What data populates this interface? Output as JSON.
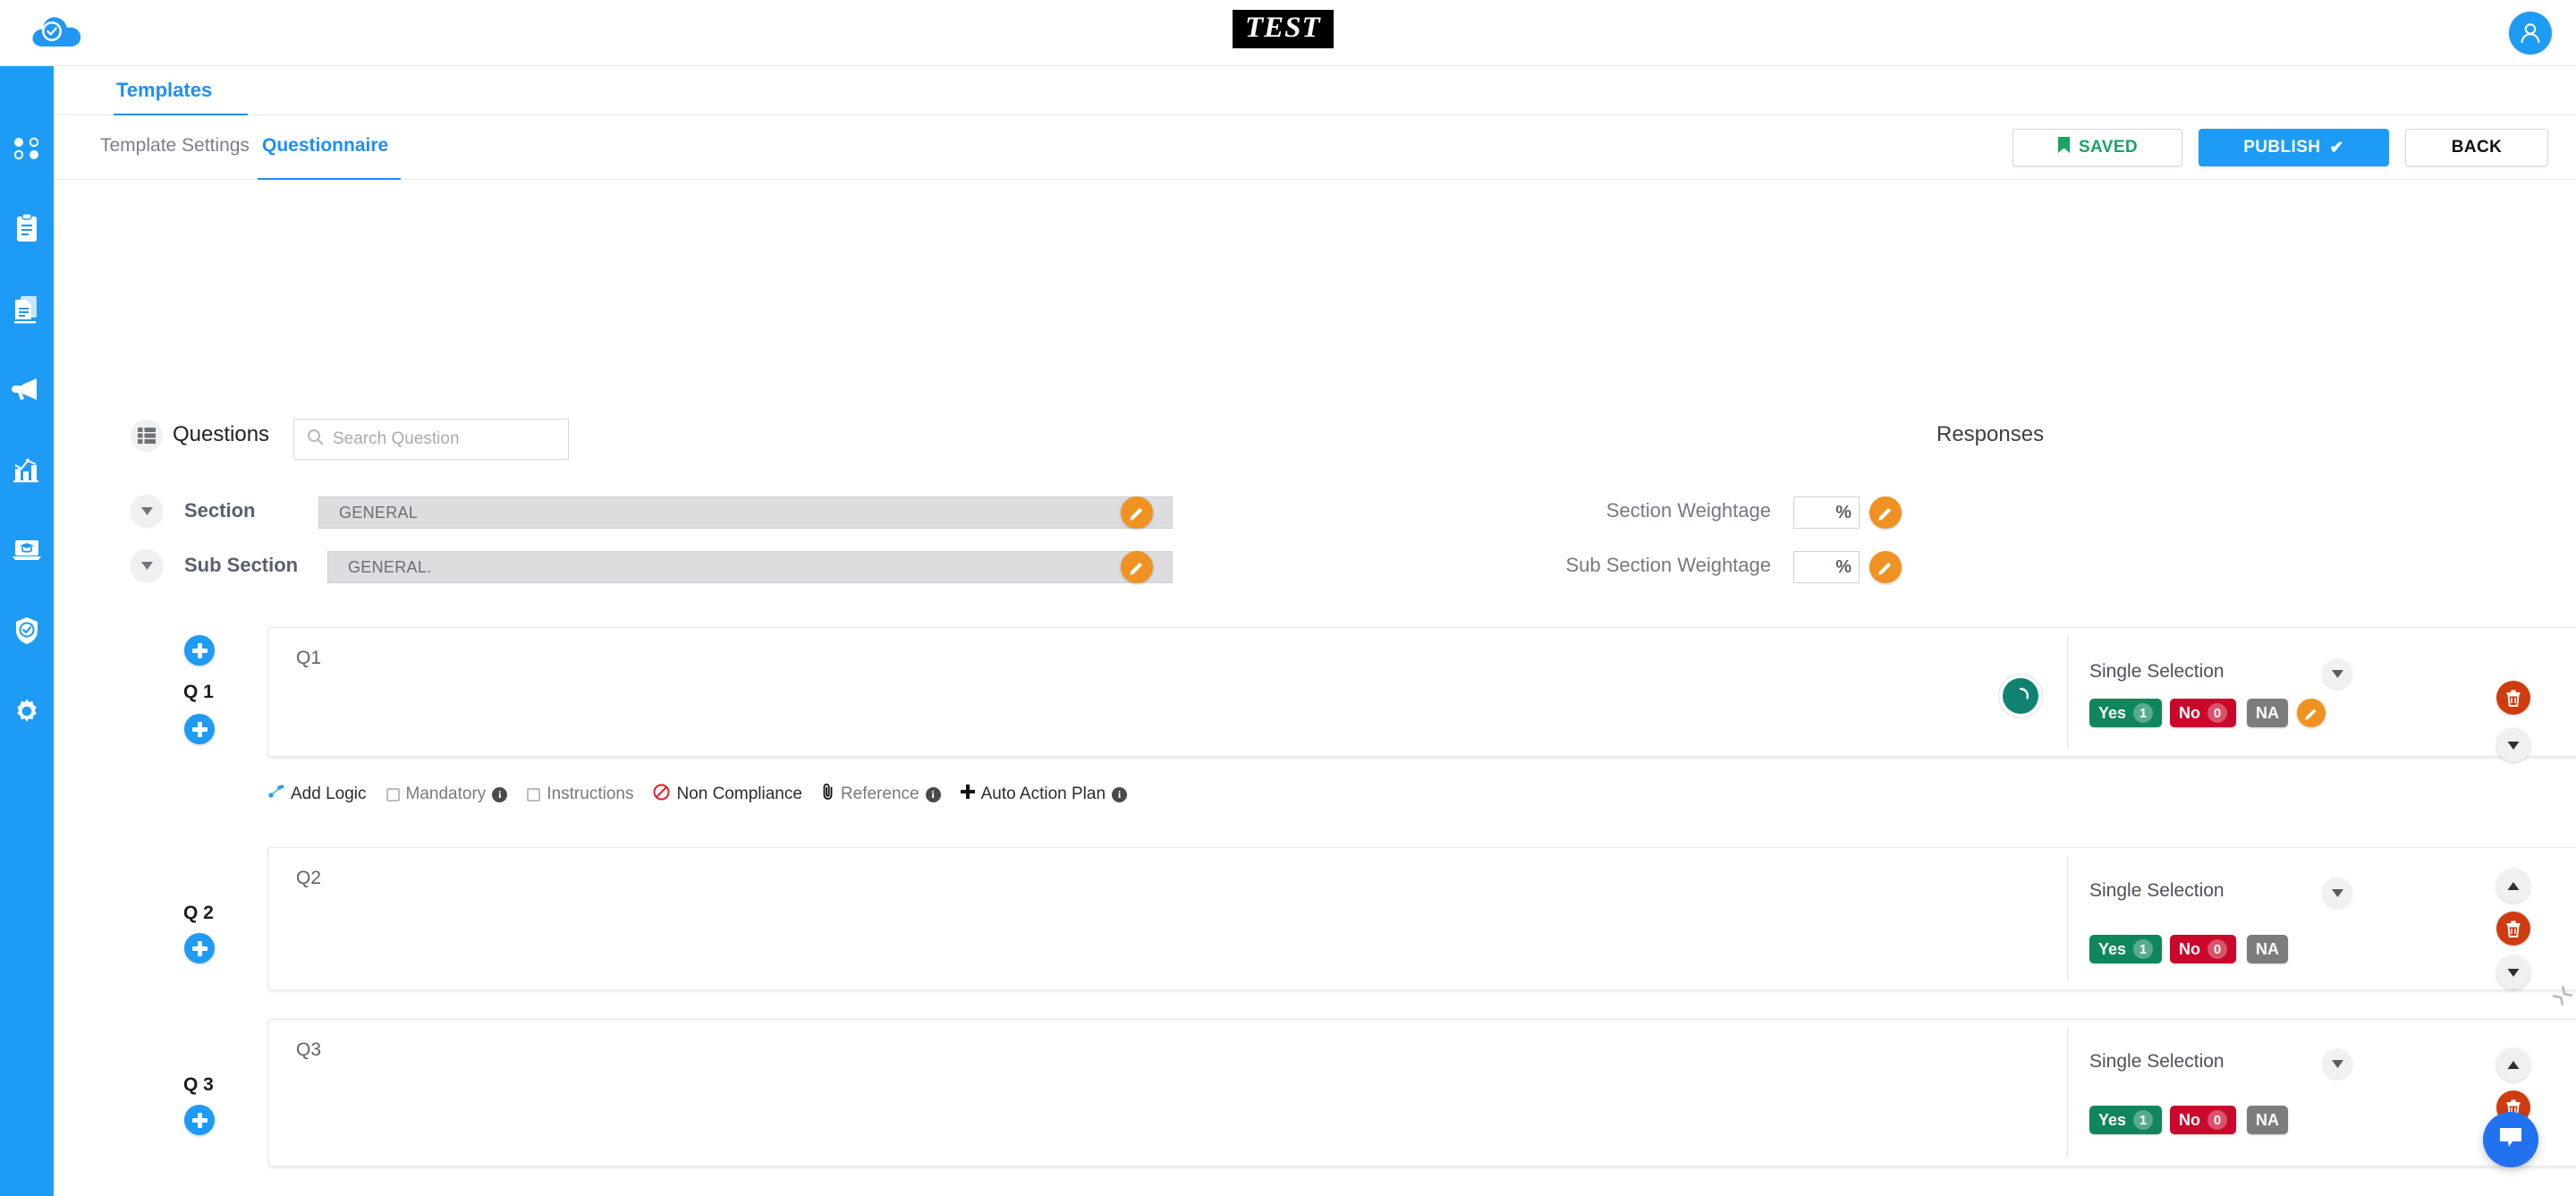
{
  "app": {
    "logo_alt": "cloud-check-logo",
    "center_logo_text": "TEST",
    "avatar_alt": "user-avatar"
  },
  "nav": {
    "items": [
      {
        "name": "dashboard",
        "icon": "four-dots-icon"
      },
      {
        "name": "clipboard",
        "icon": "clipboard-icon"
      },
      {
        "name": "documents",
        "icon": "documents-icon"
      },
      {
        "name": "announcements",
        "icon": "megaphone-icon"
      },
      {
        "name": "analytics",
        "icon": "bar-chart-icon"
      },
      {
        "name": "learning",
        "icon": "graduation-laptop-icon"
      },
      {
        "name": "compliance",
        "icon": "shield-check-icon"
      },
      {
        "name": "settings",
        "icon": "gear-icon"
      }
    ]
  },
  "tabs": {
    "primary": "Templates",
    "secondary": [
      {
        "label": "Template Settings",
        "active": false
      },
      {
        "label": "Questionnaire",
        "active": true
      }
    ]
  },
  "toolbar": {
    "saved_label": "SAVED",
    "publish_label": "PUBLISH",
    "publish_check": "✔",
    "back_label": "BACK"
  },
  "builder": {
    "questions_label": "Questions",
    "responses_label": "Responses",
    "search": {
      "value": "",
      "placeholder": "Search Question"
    },
    "section": {
      "label": "Section",
      "value": "GENERAL",
      "weightage_label": "Section Weightage",
      "weightage_value": "",
      "weightage_unit": "%"
    },
    "sub_section": {
      "label": "Sub Section",
      "value": "GENERAL.",
      "weightage_label": "Sub Section Weightage",
      "weightage_value": "",
      "weightage_unit": "%"
    },
    "response_chips": {
      "yes_label": "Yes",
      "yes_score": "1",
      "no_label": "No",
      "no_score": "0",
      "na_label": "NA"
    },
    "selection_type": "Single Selection",
    "questions": [
      {
        "rail": "Q 1",
        "text": "Q1",
        "type": "Single Selection",
        "expanded": true
      },
      {
        "rail": "Q 2",
        "text": "Q2",
        "type": "Single Selection",
        "expanded": false
      },
      {
        "rail": "Q 3",
        "text": "Q3",
        "type": "Single Selection",
        "expanded": false
      }
    ],
    "question_toolbar": [
      {
        "label": "Add Logic",
        "icon": "logic-dots-icon",
        "info": false,
        "check": false
      },
      {
        "label": "Mandatory",
        "icon": "checkbox-icon",
        "info": true,
        "check": true
      },
      {
        "label": "Instructions",
        "icon": "checkbox-icon",
        "info": false,
        "check": true
      },
      {
        "label": "Non Compliance",
        "icon": "prohibition-icon",
        "info": false,
        "check": false
      },
      {
        "label": "Reference",
        "icon": "paperclip-icon",
        "info": true,
        "check": false
      },
      {
        "label": "Auto Action Plan",
        "icon": "plus-icon",
        "info": true,
        "check": false
      }
    ]
  },
  "colors": {
    "brand_blue": "#1e9bf5",
    "yes_green": "#10875b",
    "no_red": "#c9082b",
    "na_gray": "#7c7c7c",
    "edit_orange": "#ef9221",
    "delete_red": "#cf3c10",
    "saved_green": "#18a463"
  },
  "chat": {
    "name": "support-chat",
    "icon": "chat-bubble-icon"
  }
}
